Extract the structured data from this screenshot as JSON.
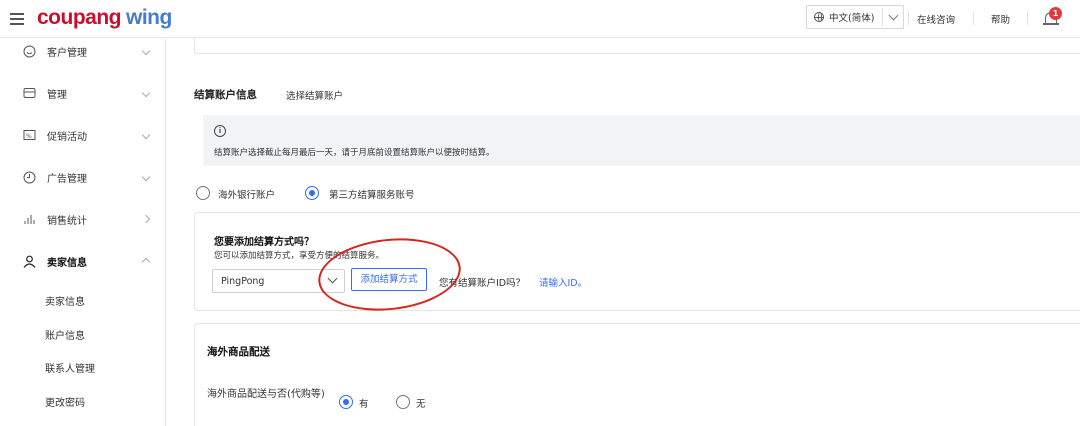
{
  "header": {
    "logo_brand": "coupang",
    "logo_product": "wing",
    "language": "中文(简体)",
    "support_link": "在线咨询",
    "help_link": "帮助",
    "notification_count": "1"
  },
  "sidebar": {
    "items": [
      {
        "label": "客户管理",
        "icon": "smile-icon"
      },
      {
        "label": "管理",
        "icon": "wallet-icon"
      },
      {
        "label": "促销活动",
        "icon": "coupon-icon"
      },
      {
        "label": "广告管理",
        "icon": "clock-icon"
      },
      {
        "label": "销售统计",
        "icon": "bar-chart-icon"
      },
      {
        "label": "卖家信息",
        "icon": "user-icon"
      }
    ],
    "sub_items": [
      "卖家信息",
      "账户信息",
      "联系人管理",
      "更改密码"
    ]
  },
  "settlement": {
    "title": "结算账户信息",
    "subtitle": "选择结算账户",
    "notice": "结算账户选择截止每月最后一天，请于月底前设置结算账户以便按时结算。",
    "option_bank": "海外银行账户",
    "option_third_party": "第三方结算服务账号",
    "selected": "third_party"
  },
  "add_method": {
    "question": "您要添加结算方式吗？",
    "description": "您可以添加结算方式，享受方便的结算服务。",
    "selected_provider": "PingPong",
    "add_button": "添加结算方式",
    "id_question": "您有结算账户ID吗？",
    "id_link": "请输入ID。"
  },
  "shipping": {
    "title": "海外商品配送",
    "question": "海外商品配送与否(代购等)",
    "option_yes": "有",
    "option_no": "无",
    "selected": "yes"
  },
  "colors": {
    "brand_red": "#c8102e",
    "brand_blue": "#4a7bc8",
    "accent": "#346aff",
    "annotation_red": "#d6251f"
  }
}
